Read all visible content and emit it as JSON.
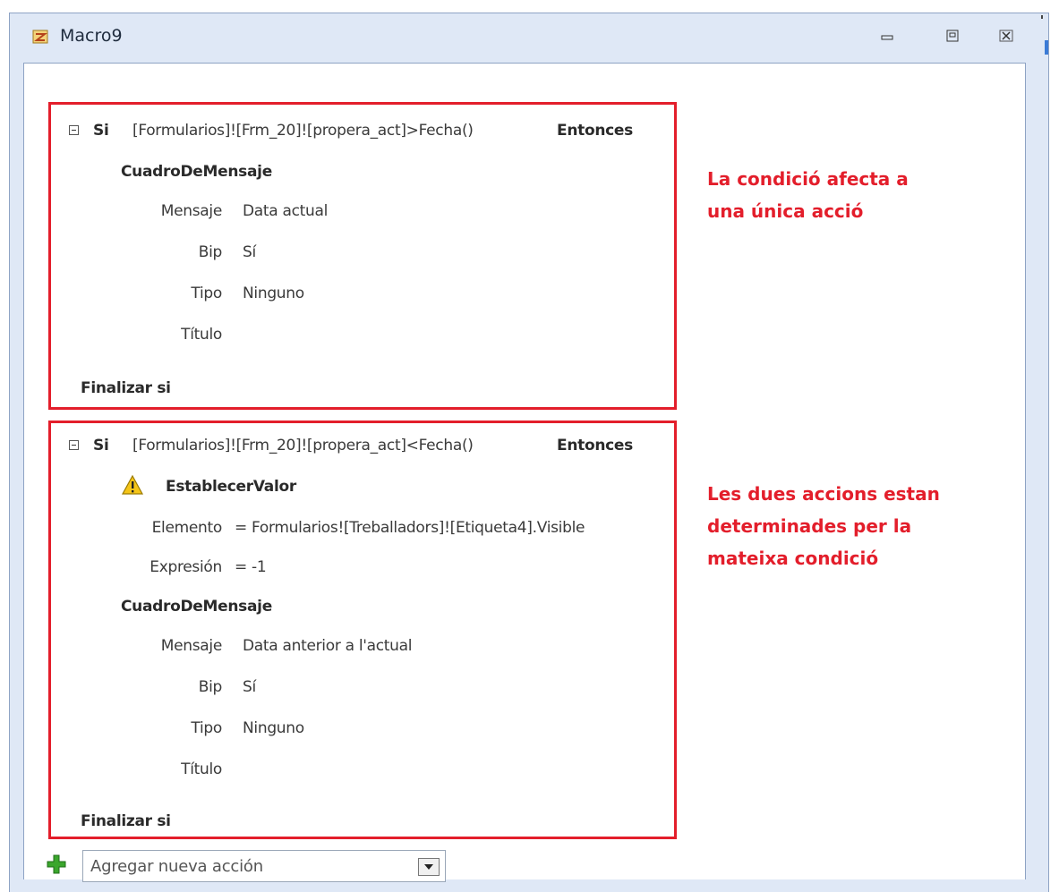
{
  "window": {
    "title": "Macro9"
  },
  "blocks": [
    {
      "if_keyword": "Si",
      "condition": "[Formularios]![Frm_20]![propera_act]>Fecha()",
      "then_keyword": "Entonces",
      "actions": [
        {
          "name": "CuadroDeMensaje",
          "warning": false,
          "args": [
            {
              "label": "Mensaje",
              "value": "Data actual"
            },
            {
              "label": "Bip",
              "value": "Sí"
            },
            {
              "label": "Tipo",
              "value": "Ninguno"
            },
            {
              "label": "Título",
              "value": ""
            }
          ]
        }
      ],
      "end_keyword": "Finalizar si"
    },
    {
      "if_keyword": "Si",
      "condition": "[Formularios]![Frm_20]![propera_act]<Fecha()",
      "then_keyword": "Entonces",
      "actions": [
        {
          "name": "EstablecerValor",
          "warning": true,
          "args": [
            {
              "label": "Elemento",
              "value": "= Formularios![Treballadors]![Etiqueta4].Visible"
            },
            {
              "label": "Expresión",
              "value": "= -1"
            }
          ]
        },
        {
          "name": "CuadroDeMensaje",
          "warning": false,
          "args": [
            {
              "label": "Mensaje",
              "value": "Data anterior a l'actual"
            },
            {
              "label": "Bip",
              "value": "Sí"
            },
            {
              "label": "Tipo",
              "value": "Ninguno"
            },
            {
              "label": "Título",
              "value": ""
            }
          ]
        }
      ],
      "end_keyword": "Finalizar si"
    }
  ],
  "notes": [
    [
      "La condició afecta a",
      "una única acció"
    ],
    [
      "Les dues accions estan",
      "determinades per la",
      "mateixa condició"
    ]
  ],
  "add_action": {
    "placeholder": "Agregar nueva acción"
  },
  "colors": {
    "highlight_border": "#e31e2b",
    "note_text": "#e31e2b",
    "window_frame": "#dfe8f6"
  }
}
